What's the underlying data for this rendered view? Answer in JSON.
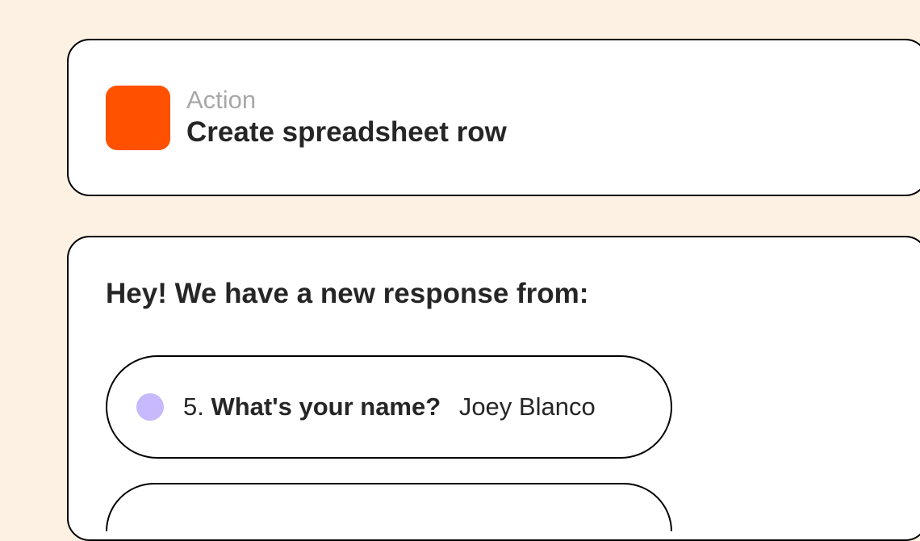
{
  "action": {
    "label": "Action",
    "title": "Create spreadsheet row",
    "icon_color": "#FF5100"
  },
  "response": {
    "heading": "Hey! We have a new response from:",
    "items": [
      {
        "number": "5.",
        "question": "What's your name?",
        "answer": "Joey Blanco",
        "dot_color": "#C7B9FB"
      }
    ]
  }
}
